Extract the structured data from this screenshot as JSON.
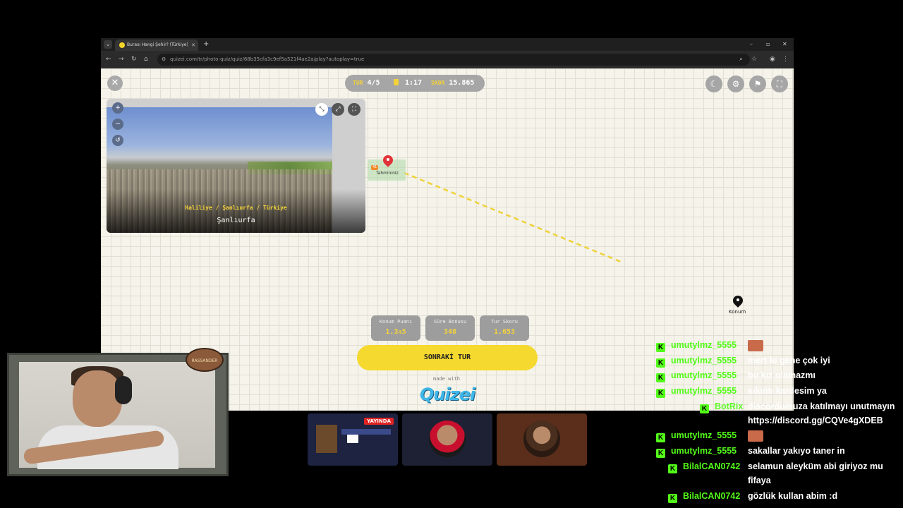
{
  "browser": {
    "tab_title": "Burası Hangi Şehir? (Türkiye) -",
    "url": "quizei.com/tr/photo-quiz/quiz/68b35cfa3c9ef5a521f4ae2a/play?autoplay=true"
  },
  "hud": {
    "round_label": "TUR",
    "round_value": "4/5",
    "timer_value": "1:17",
    "score_label": "SKOR",
    "score_value": "15.865"
  },
  "photo": {
    "subtitle": "Haliliye / Şanlıurfa / Türkiye",
    "city": "Şanlıurfa"
  },
  "map": {
    "guess_tag": "41",
    "guess_label": "Tahmininiz",
    "answer_label": "Konum"
  },
  "scores": [
    {
      "title": "Konum Puanı",
      "value": "1.3ᴀ5"
    },
    {
      "title": "Süre Bonusu",
      "value": "348"
    },
    {
      "title": "Tur Skoru",
      "value": "1.653"
    }
  ],
  "buttons": {
    "next": "SONRAKİ TUR"
  },
  "branding": {
    "made_with": "made with",
    "logo": "Quizei"
  },
  "webcam": {
    "badge": "RASSANDER"
  },
  "clips": {
    "live_label": "YAYINDA"
  },
  "chat": [
    {
      "user": "umutylmz_5555",
      "text": "",
      "emote": true
    },
    {
      "user": "umutylmz_5555",
      "text": "mert lu gene çok iyi"
    },
    {
      "user": "umutylmz_5555",
      "text": "bu kız olamazmı"
    },
    {
      "user": "umutylmz_5555",
      "text": "sıkıntı kardesim ya"
    },
    {
      "user": "BotRix",
      "text": "discordumuza katılmayı unutmayın"
    },
    {
      "user": "",
      "text": "https://discord.gg/CQVe4gXDEB"
    },
    {
      "user": "umutylmz_5555",
      "text": "",
      "emote": true
    },
    {
      "user": "umutylmz_5555",
      "text": "sakallar yakıyo taner in"
    },
    {
      "user": "BilalCAN0742",
      "text": "selamun aleyküm abi giriyoz mu"
    },
    {
      "user": "",
      "text": "fifaya"
    },
    {
      "user": "BilalCAN0742",
      "text": "gözlük kullan abim :d"
    }
  ]
}
